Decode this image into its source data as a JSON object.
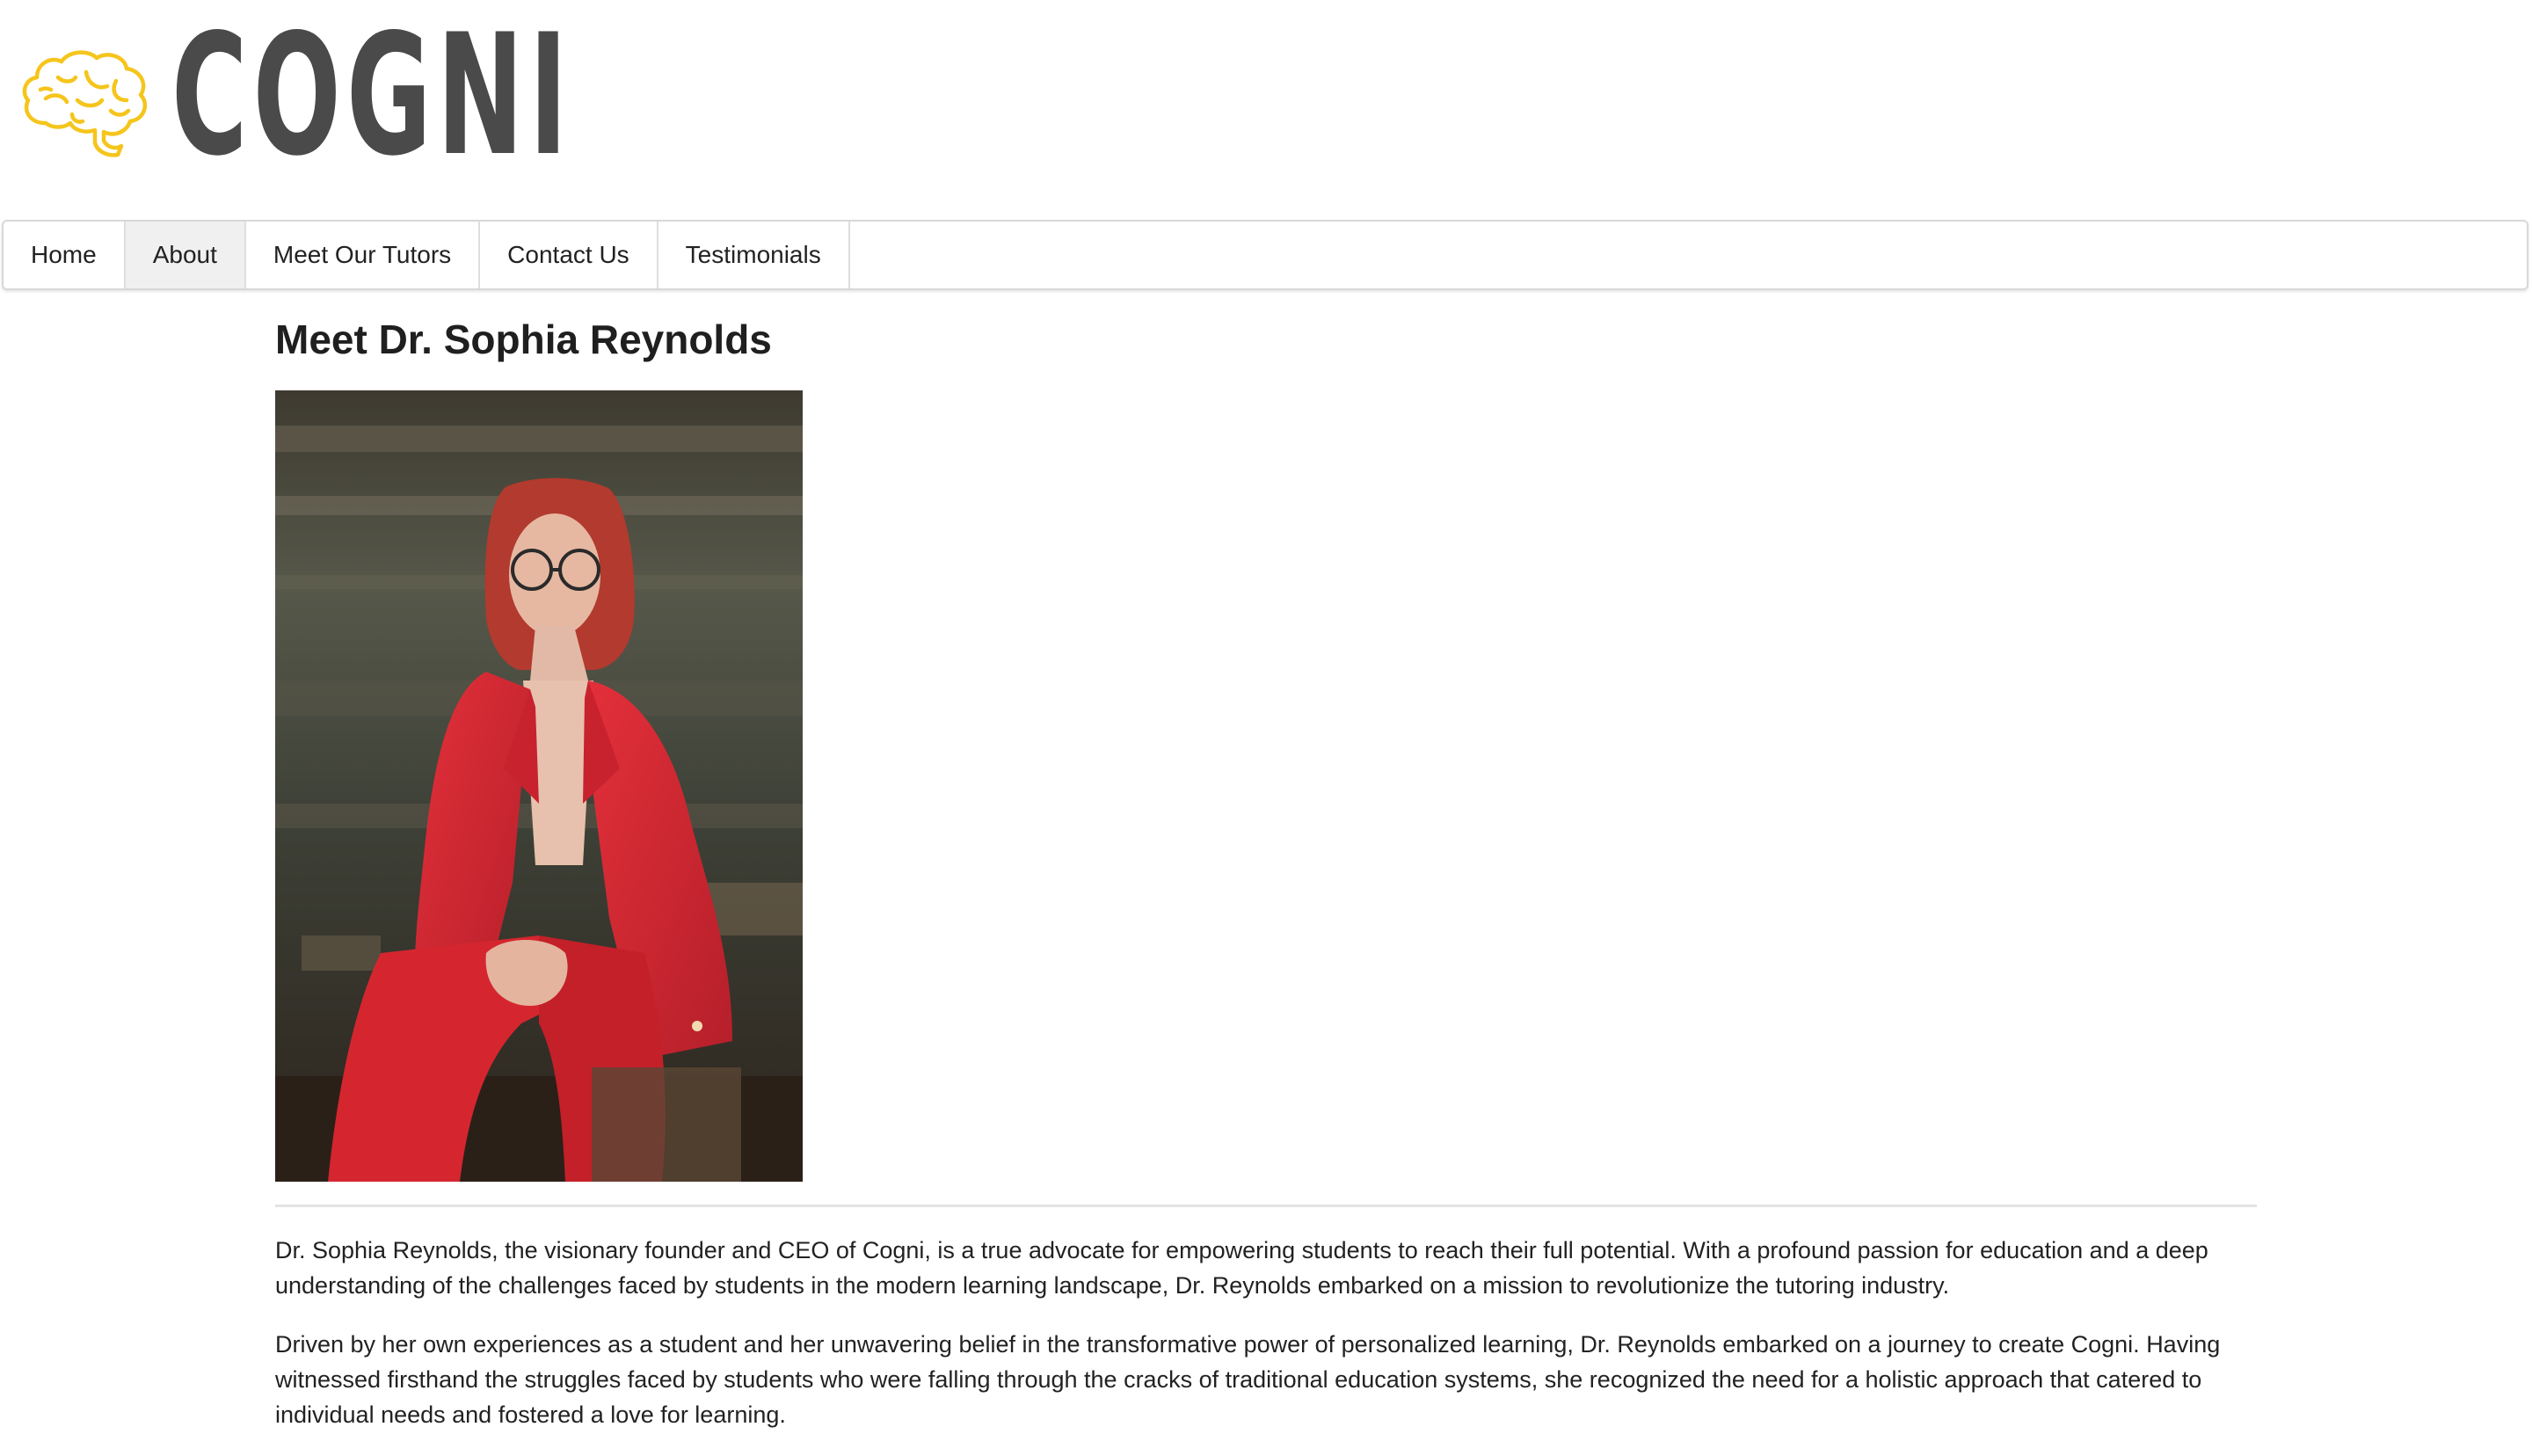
{
  "brand": {
    "name": "COGNI",
    "logo_icon": "brain-icon",
    "logo_color": "#f5c51c"
  },
  "nav": {
    "items": [
      {
        "label": "Home",
        "active": false
      },
      {
        "label": "About",
        "active": true
      },
      {
        "label": "Meet Our Tutors",
        "active": false
      },
      {
        "label": "Contact Us",
        "active": false
      },
      {
        "label": "Testimonials",
        "active": false
      }
    ]
  },
  "main": {
    "title": "Meet Dr. Sophia Reynolds",
    "paragraphs": [
      "Dr. Sophia Reynolds, the visionary founder and CEO of Cogni, is a true advocate for empowering students to reach their full potential. With a profound passion for education and a deep understanding of the challenges faced by students in the modern learning landscape, Dr. Reynolds embarked on a mission to revolutionize the tutoring industry.",
      "Driven by her own experiences as a student and her unwavering belief in the transformative power of personalized learning, Dr. Reynolds embarked on a journey to create Cogni. Having witnessed firsthand the struggles faced by students who were falling through the cracks of traditional education systems, she recognized the need for a holistic approach that catered to individual needs and fostered a love for learning."
    ]
  },
  "colors": {
    "accent_red": "#d42a35",
    "text": "#222222",
    "logo_text": "#4a4a4a"
  }
}
